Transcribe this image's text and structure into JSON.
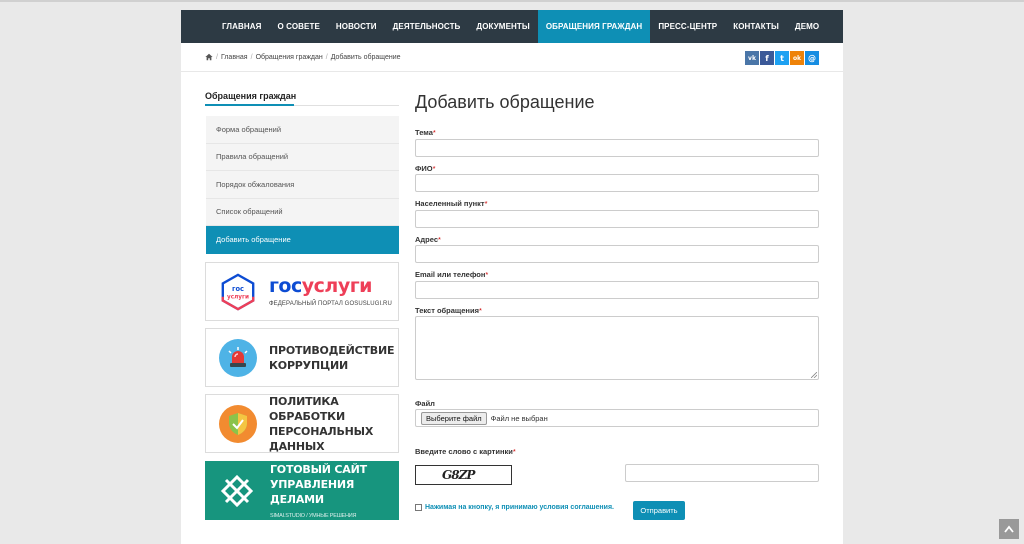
{
  "nav": {
    "items": [
      "Главная",
      "О совете",
      "Новости",
      "Деятельность",
      "Документы",
      "Обращения граждан",
      "Пресс-центр",
      "Контакты",
      "Демо"
    ],
    "active_index": 5
  },
  "breadcrumb": {
    "home_icon": "home-icon",
    "items": [
      "Главная",
      "Обращения граждан",
      "Добавить обращение"
    ]
  },
  "social": {
    "vk": {
      "label": "vk",
      "color": "#4a76a8"
    },
    "facebook": {
      "label": "f",
      "color": "#3b5998"
    },
    "twitter": {
      "label": "t",
      "color": "#1da1f2"
    },
    "odnoklassniki": {
      "label": "ok",
      "color": "#ee8208"
    },
    "moimir": {
      "label": "@",
      "color": "#168de2"
    }
  },
  "sidebar": {
    "title": "Обращения граждан",
    "items": [
      {
        "label": "Форма обращений"
      },
      {
        "label": "Правила обращений"
      },
      {
        "label": "Порядок обжалования"
      },
      {
        "label": "Список обращений"
      },
      {
        "label": "Добавить обращение"
      }
    ],
    "active_index": 4
  },
  "banners": {
    "gosuslugi": {
      "logo_line1": "гос",
      "logo_line2": "услуги",
      "title_part1": "гос",
      "title_part2": "услуги",
      "subtitle": "ФЕДЕРАЛЬНЫЙ ПОРТАЛ GOSUSLUGI.RU"
    },
    "corruption": {
      "line1": "Противодействие",
      "line2": "коррупции"
    },
    "personal_data": {
      "line1": "Политика обработки",
      "line2": "персональных данных"
    },
    "site": {
      "line1": "Готовый сайт",
      "line2": "управления делами",
      "small": "SIMAI.STUDIO / УМНЫЕ РЕШЕНИЯ"
    }
  },
  "form": {
    "title": "Добавить обращение",
    "required_mark": "*",
    "fields": {
      "subject": {
        "label": "Тема",
        "value": ""
      },
      "fio": {
        "label": "ФИО",
        "value": ""
      },
      "locality": {
        "label": "Населенный пункт",
        "value": ""
      },
      "address": {
        "label": "Адрес",
        "value": ""
      },
      "contact": {
        "label": "Email или телефон",
        "value": ""
      },
      "text": {
        "label": "Текст обращения",
        "value": ""
      }
    },
    "file": {
      "label": "Файл",
      "button": "Выберите файл",
      "status": "Файл не выбран"
    },
    "captcha": {
      "label": "Введите слово с картинки",
      "image_text": "G8ZP",
      "value": ""
    },
    "agree_text": "Нажимая на кнопку, я принимаю условия соглашения.",
    "submit": "Отправить"
  },
  "colors": {
    "accent": "#0e8fb5",
    "nav_bg": "#2d3a44",
    "gos_blue": "#0d4cd3",
    "gos_red": "#ee3f58"
  }
}
